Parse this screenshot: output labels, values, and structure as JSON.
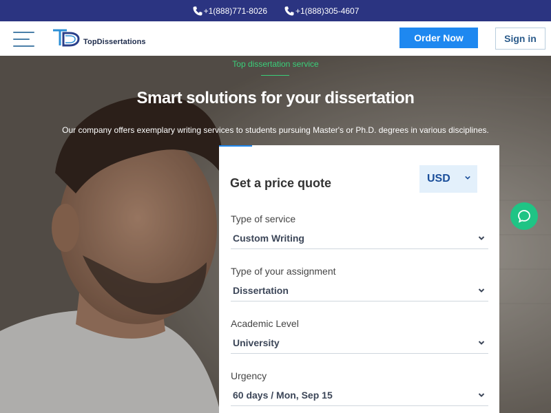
{
  "topbar": {
    "phones": [
      "+1(888)771-8026",
      "+1(888)305-4607"
    ]
  },
  "header": {
    "brand": "TopDissertations",
    "order_label": "Order Now",
    "signin_label": "Sign in"
  },
  "hero": {
    "eyebrow": "Top dissertation service",
    "title": "Smart solutions for your dissertation",
    "subtitle": "Our company offers exemplary writing services to students pursuing Master's or Ph.D. degrees in various disciplines."
  },
  "quote": {
    "title": "Get a price quote",
    "currency": "USD",
    "fields": [
      {
        "label": "Type of service",
        "value": "Custom Writing"
      },
      {
        "label": "Type of your assignment",
        "value": "Dissertation"
      },
      {
        "label": "Academic Level",
        "value": "University"
      },
      {
        "label": "Urgency",
        "value": "60 days / Mon, Sep 15"
      }
    ]
  },
  "colors": {
    "topbar": "#2b3481",
    "accent_blue": "#1e88f0",
    "accent_green": "#3ad07a",
    "chat_green": "#1fc485"
  },
  "icons": [
    "phone-icon",
    "menu-icon",
    "chevron-down-icon",
    "chat-icon"
  ]
}
